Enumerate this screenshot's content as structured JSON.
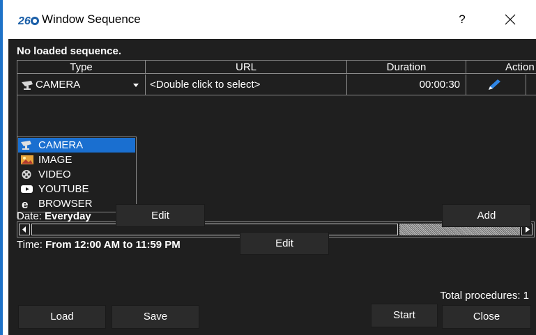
{
  "window": {
    "title": "Window Sequence",
    "help_label": "?",
    "logo_text": "26"
  },
  "status_text": "No loaded sequence.",
  "table": {
    "columns": [
      "Type",
      "URL",
      "Duration",
      "Action"
    ],
    "rows": [
      {
        "type": "CAMERA",
        "url": "<Double click to select>",
        "duration": "00:00:30",
        "action_icon": "pencil-icon"
      }
    ]
  },
  "type_dropdown": {
    "selected": "CAMERA",
    "options": [
      {
        "label": "CAMERA",
        "icon": "camera-icon"
      },
      {
        "label": "IMAGE",
        "icon": "image-icon"
      },
      {
        "label": "VIDEO",
        "icon": "video-reel-icon"
      },
      {
        "label": "YOUTUBE",
        "icon": "youtube-icon"
      },
      {
        "label": "BROWSER",
        "icon": "browser-icon"
      }
    ]
  },
  "schedule": {
    "date_label": "Date:",
    "date_value": "Everyday",
    "time_label": "Time:",
    "time_value": "From 12:00 AM to 11:59 PM",
    "edit_label": "Edit"
  },
  "buttons": {
    "add": "Add",
    "load": "Load",
    "save": "Save",
    "start": "Start",
    "close": "Close"
  },
  "total_procedures": "Total procedures: 1",
  "colors": {
    "background": "#1f1f1f",
    "selection": "#1a6fd0",
    "accent": "#1e72c8",
    "pencil": "#2f86e6"
  }
}
